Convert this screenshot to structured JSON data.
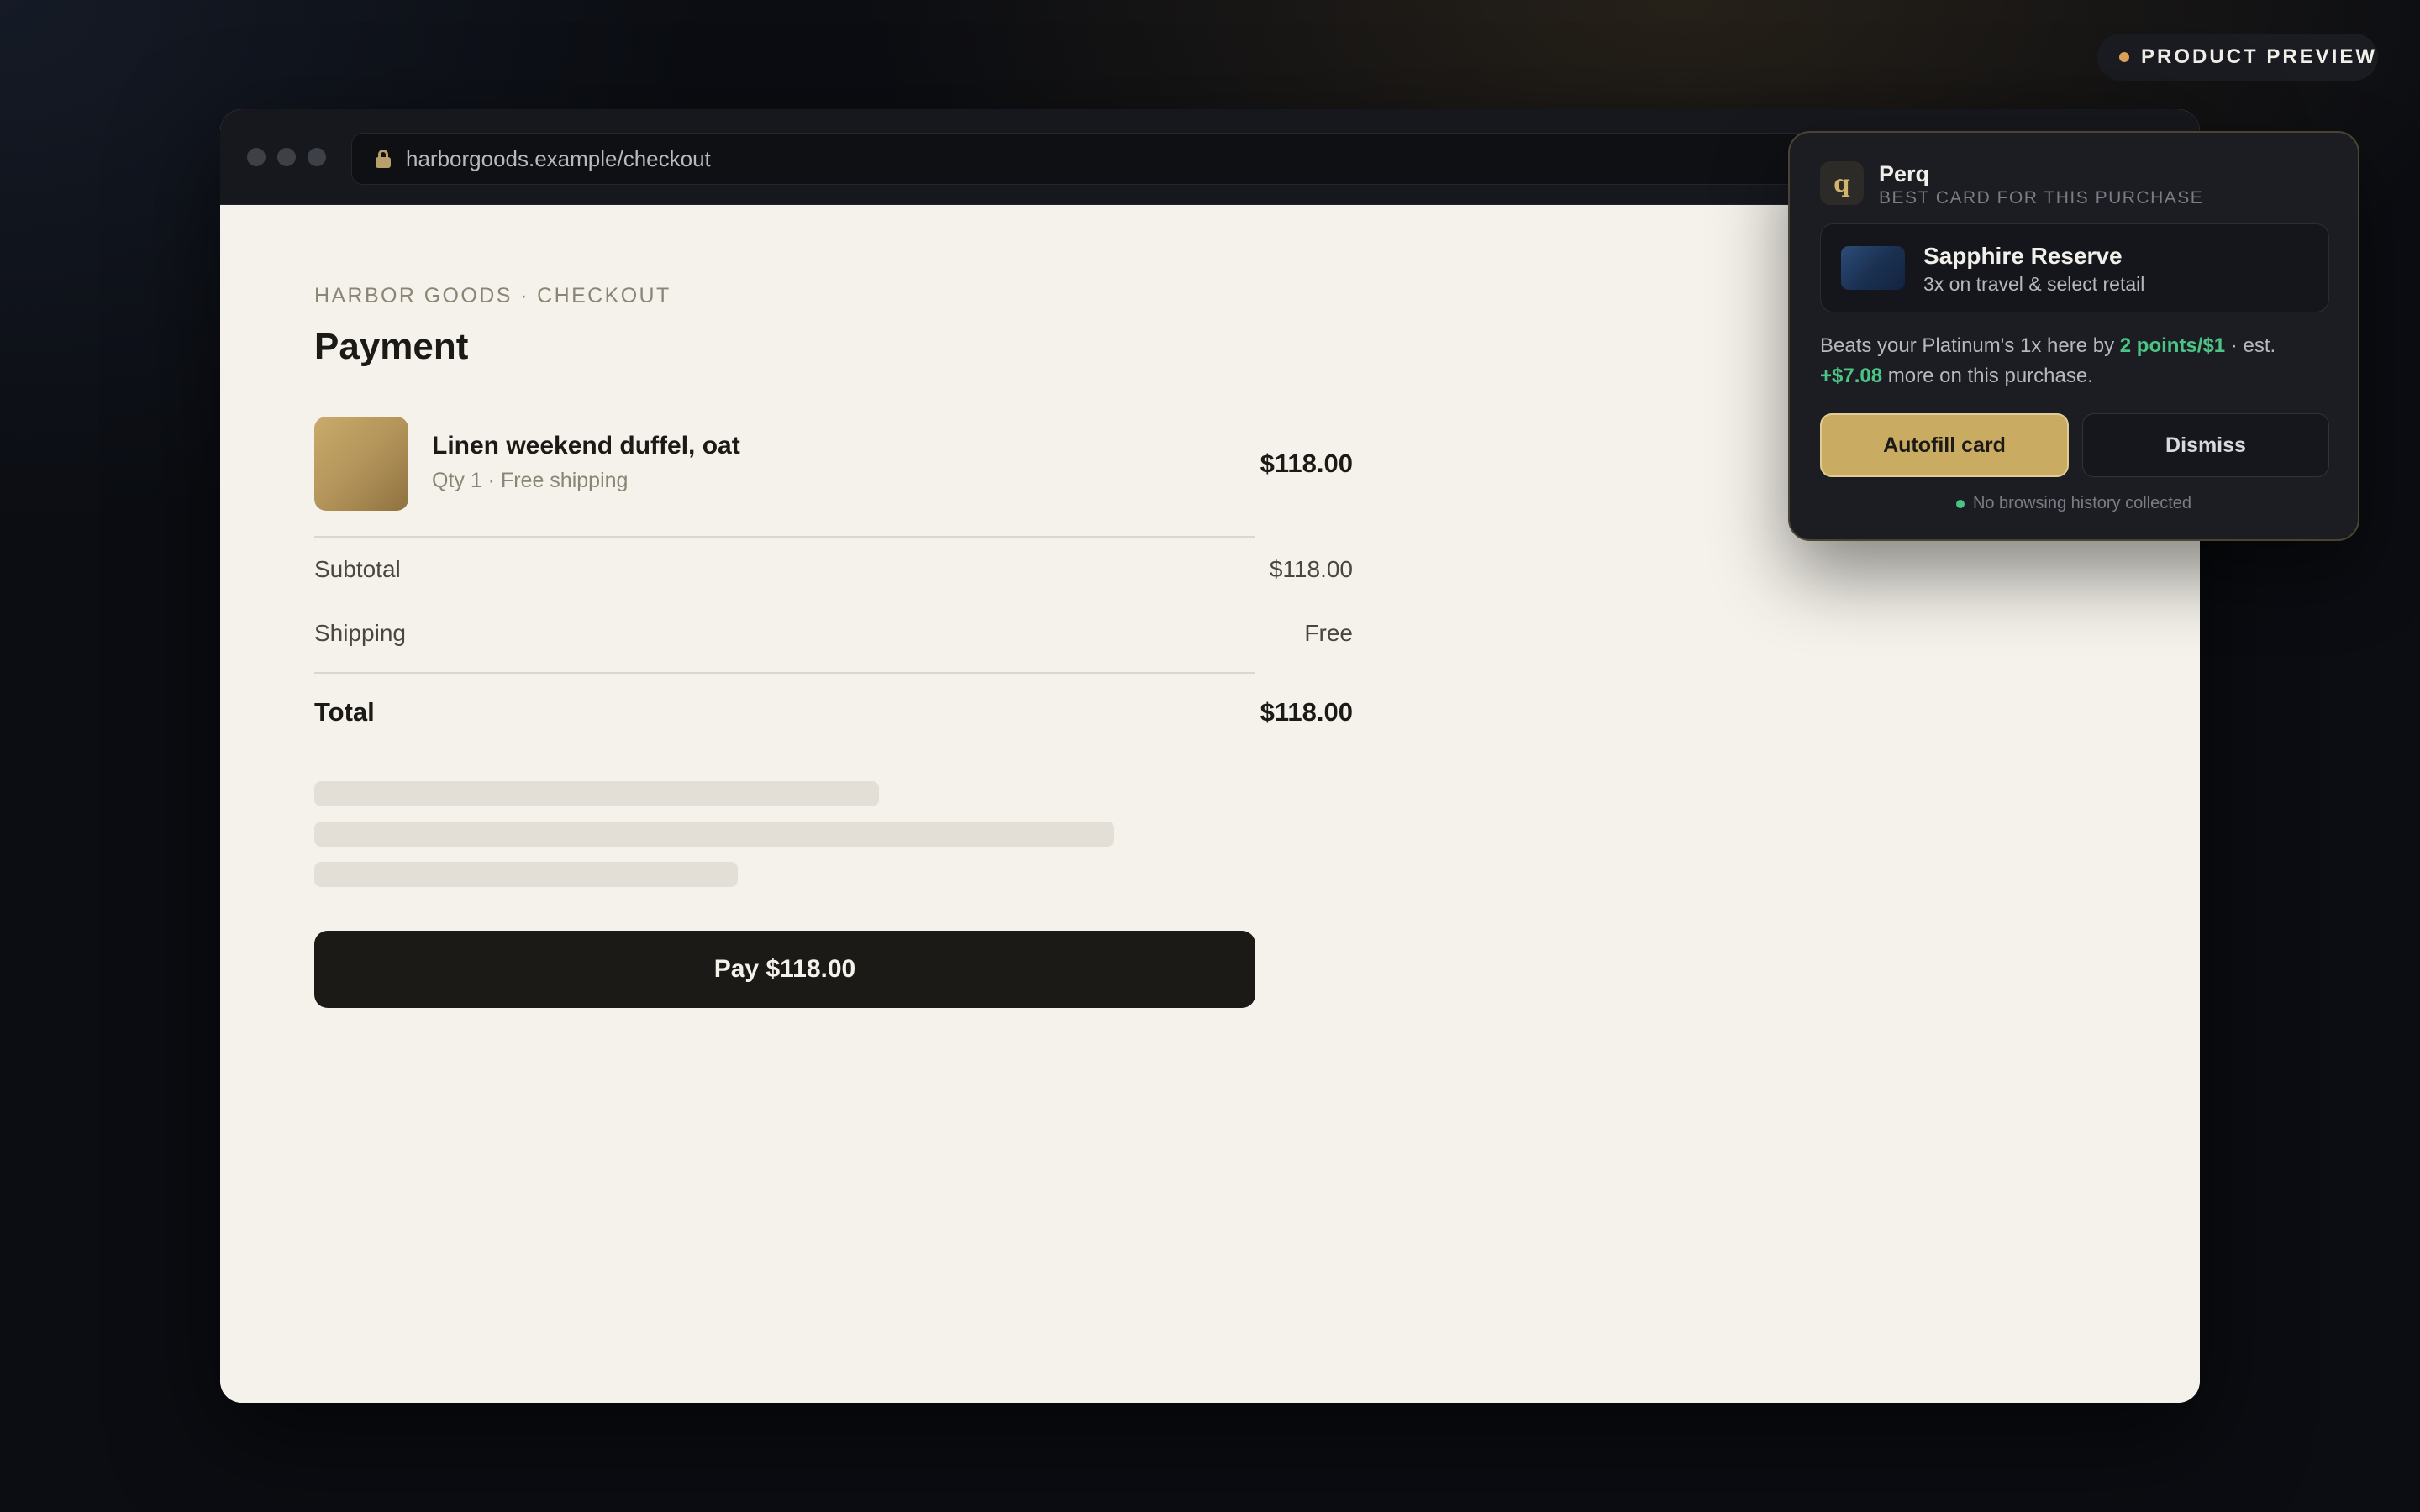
{
  "badge": {
    "label": "PRODUCT PREVIEW",
    "dot_color": "#e0a458"
  },
  "browser": {
    "url": "harborgoods.example/checkout",
    "lock_icon": "lock-icon"
  },
  "checkout": {
    "breadcrumb": "HARBOR GOODS · CHECKOUT",
    "title": "Payment",
    "item": {
      "name": "Linen weekend duffel, oat",
      "meta": "Qty 1 · Free shipping",
      "price": "$118.00"
    },
    "summary": [
      {
        "label": "Subtotal",
        "value": "$118.00"
      },
      {
        "label": "Shipping",
        "value": "Free"
      }
    ],
    "total": {
      "label": "Total",
      "value": "$118.00"
    },
    "pay_button": "Pay $118.00"
  },
  "extension": {
    "logo_glyph": "q",
    "name": "Perq",
    "subtitle": "BEST CARD FOR THIS PURCHASE",
    "card": {
      "name": "Sapphire Reserve",
      "description": "3x on travel & select retail"
    },
    "pitch": {
      "part1": "Beats your Platinum's 1x here by ",
      "highlight1": "2 points/$1",
      "part2": " · est. ",
      "highlight2": "+$7.08",
      "part3": " more on this purchase."
    },
    "autofill_label": "Autofill card",
    "dismiss_label": "Dismiss",
    "privacy_note": "No browsing history collected",
    "accent_color": "#c9ab62",
    "positive_color": "#4cc486"
  }
}
